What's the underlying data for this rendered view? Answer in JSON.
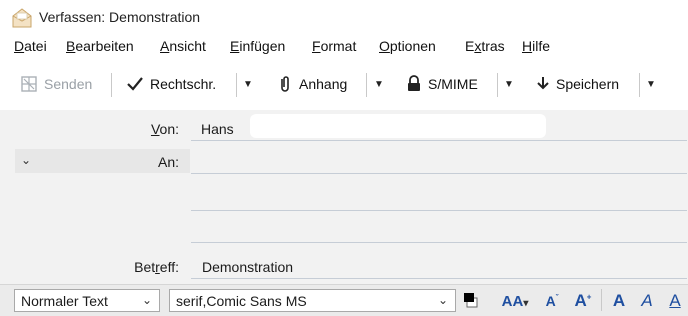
{
  "window": {
    "title": "Verfassen: Demonstration"
  },
  "menubar": {
    "items": [
      {
        "label": "Datei"
      },
      {
        "label": "Bearbeiten"
      },
      {
        "label": "Ansicht"
      },
      {
        "label": "Einfügen"
      },
      {
        "label": "Format"
      },
      {
        "label": "Optionen"
      },
      {
        "label": "Extras"
      },
      {
        "label": "Hilfe"
      }
    ]
  },
  "toolbar": {
    "send_label": "Senden",
    "spell_label": "Rechtschr.",
    "attach_label": "Anhang",
    "smime_label": "S/MIME",
    "save_label": "Speichern"
  },
  "headers": {
    "from_label": "Von:",
    "from_value": "Hans",
    "to_label": "An:",
    "subject_label": "Betreff:",
    "subject_value": "Demonstration"
  },
  "format": {
    "paragraph_style": "Normaler Text",
    "font_family": "serif,Comic Sans MS"
  },
  "colors": {
    "accent": "#1f4fa0",
    "header_bg": "#f2f2f2",
    "field_line": "#c6cdd6"
  }
}
